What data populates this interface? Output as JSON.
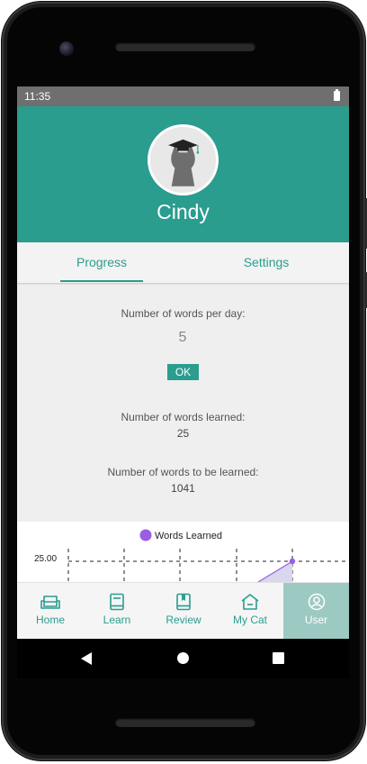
{
  "status_bar": {
    "time": "11:35"
  },
  "profile": {
    "name": "Cindy"
  },
  "tabs": [
    {
      "label": "Progress",
      "active": true
    },
    {
      "label": "Settings",
      "active": false
    }
  ],
  "progress": {
    "words_per_day_label": "Number of words per day:",
    "words_per_day_value": "5",
    "ok_label": "OK",
    "words_learned_label": "Number of words learned:",
    "words_learned_value": "25",
    "words_to_learn_label": "Number of words to be learned:",
    "words_to_learn_value": "1041"
  },
  "chart": {
    "legend_label": "Words Learned",
    "y_tick_label": "25.00",
    "series_color": "#9b5de5"
  },
  "chart_data": {
    "type": "area",
    "series": [
      {
        "name": "Words Learned",
        "values": [
          0,
          25
        ]
      }
    ],
    "y_ticks": [
      "25.00"
    ],
    "grid": true,
    "legend": "top-center"
  },
  "bottom_nav": [
    {
      "label": "Home",
      "icon": "sofa-icon",
      "active": false
    },
    {
      "label": "Learn",
      "icon": "book-icon",
      "active": false
    },
    {
      "label": "Review",
      "icon": "bookmark-book-icon",
      "active": false
    },
    {
      "label": "My Cat",
      "icon": "house-icon",
      "active": false
    },
    {
      "label": "User",
      "icon": "user-circle-icon",
      "active": true
    }
  ],
  "colors": {
    "primary": "#2a9d8f",
    "active_nav_bg": "#9dc9c3",
    "chart_series": "#9b5de5"
  }
}
